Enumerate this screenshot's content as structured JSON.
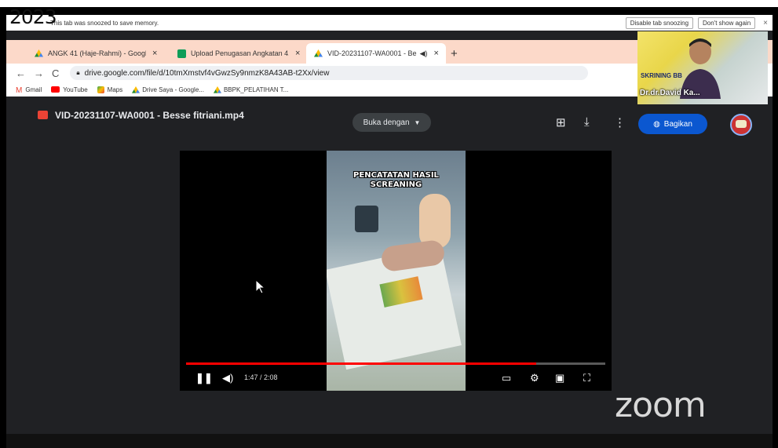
{
  "overlay": {
    "year": "2023"
  },
  "snooze_bar": {
    "message": "This tab was snoozed to save memory.",
    "disable_label": "Disable tab snoozing",
    "dont_show_label": "Don't show again",
    "close_glyph": "×"
  },
  "tabs": [
    {
      "label": "ANGK 41 (Haje-Rahmi) - Google",
      "icon": "google-drive-icon",
      "active": false
    },
    {
      "label": "Upload Penugasan Angkatan 41",
      "icon": "google-sheets-icon",
      "active": false
    },
    {
      "label": "VID-20231107-WA0001 - Be",
      "icon": "google-drive-icon",
      "active": true
    }
  ],
  "browser": {
    "url": "drive.google.com/file/d/10tmXmstvf4vGwzSy9nmzK8A43AB-t2Xx/view",
    "new_tab": "+"
  },
  "bookmarks": [
    {
      "label": "Gmail",
      "icon": "gmail-icon"
    },
    {
      "label": "YouTube",
      "icon": "youtube-icon"
    },
    {
      "label": "Maps",
      "icon": "maps-icon"
    },
    {
      "label": "Drive Saya - Google...",
      "icon": "google-drive-icon"
    },
    {
      "label": "BBPK_PELATIHAN T...",
      "icon": "google-drive-icon"
    }
  ],
  "drive": {
    "file_name": "VID-20231107-WA0001 - Besse fitriani.mp4",
    "open_with": "Buka dengan",
    "share": "Bagikan"
  },
  "video": {
    "caption_line1": "PENCATATAN HASIL",
    "caption_line2": "SCREANING",
    "current_time": "1:47",
    "duration": "2:08",
    "time_display": "1:47 / 2:08",
    "progress": 0.836
  },
  "presenter": {
    "banner_text": "SKRINING BB",
    "name": "Dr.dr.David Ka..."
  },
  "zoom": {
    "logo": "zoom"
  },
  "colors": {
    "share_blue": "#0b57d0",
    "progress_red": "#ff0000",
    "tabbar": "#fcd9c9",
    "drive_bg": "#202124"
  }
}
